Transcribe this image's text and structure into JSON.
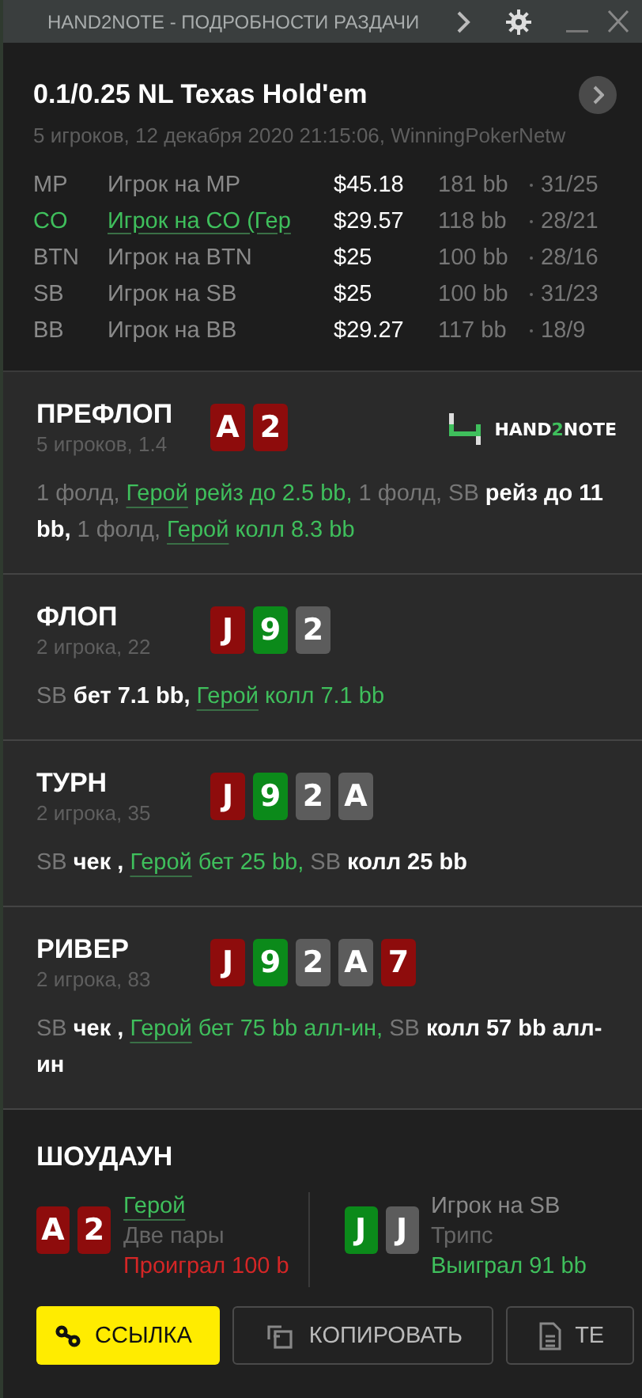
{
  "window": {
    "title": "HAND2NOTE - ПОДРОБНОСТИ РАЗДАЧИ"
  },
  "header": {
    "title": "0.1/0.25 NL Texas Hold'em",
    "subtitle": "5 игроков, 12 декабря 2020 21:15:06, WinningPokerNetw"
  },
  "players": [
    {
      "position": "MP",
      "name": "Игрок на MP",
      "stack": "$45.18",
      "bb": "181 bb",
      "stats": "31/25",
      "hero": false
    },
    {
      "position": "CO",
      "name": "Игрок на CO (Гер",
      "stack": "$29.57",
      "bb": "118 bb",
      "stats": "28/21",
      "hero": true
    },
    {
      "position": "BTN",
      "name": "Игрок на BTN",
      "stack": "$25",
      "bb": "100 bb",
      "stats": "28/16",
      "hero": false
    },
    {
      "position": "SB",
      "name": "Игрок на SB",
      "stack": "$25",
      "bb": "100 bb",
      "stats": "31/23",
      "hero": false
    },
    {
      "position": "BB",
      "name": "Игрок на BB",
      "stack": "$29.27",
      "bb": "117 bb",
      "stats": "18/9",
      "hero": false
    }
  ],
  "logo": {
    "before": "HAND",
    "accent": "2",
    "after": "NOTE"
  },
  "streets": [
    {
      "name": "ПРЕФЛОП",
      "info": "5 игроков, 1.4",
      "cards": [
        {
          "rank": "A",
          "color": "#8e0c0c"
        },
        {
          "rank": "2",
          "color": "#8e0c0c"
        }
      ],
      "actions": [
        {
          "kind": "muted",
          "text": "1 фолд, "
        },
        {
          "kind": "hero-link",
          "text": "Герой"
        },
        {
          "kind": "hero",
          "text": " рейз до 2.5 bb,"
        },
        {
          "kind": "muted",
          "text": " 1 фолд, SB"
        },
        {
          "kind": "strong",
          "text": " рейз до 11 bb,"
        },
        {
          "kind": "muted",
          "text": " 1 фолд, "
        },
        {
          "kind": "hero-link",
          "text": "Герой"
        },
        {
          "kind": "hero",
          "text": " колл 8.3 bb"
        }
      ]
    },
    {
      "name": "ФЛОП",
      "info": "2 игрока, 22",
      "cards": [
        {
          "rank": "J",
          "color": "#8e0c0c"
        },
        {
          "rank": "9",
          "color": "#0b8a1a"
        },
        {
          "rank": "2",
          "color": "#5c5c5c"
        }
      ],
      "actions": [
        {
          "kind": "muted",
          "text": "SB"
        },
        {
          "kind": "strong",
          "text": " бет 7.1 bb, "
        },
        {
          "kind": "hero-link",
          "text": "Герой"
        },
        {
          "kind": "hero",
          "text": " колл 7.1 bb"
        }
      ]
    },
    {
      "name": "ТУРН",
      "info": "2 игрока, 35",
      "cards": [
        {
          "rank": "J",
          "color": "#8e0c0c"
        },
        {
          "rank": "9",
          "color": "#0b8a1a"
        },
        {
          "rank": "2",
          "color": "#5c5c5c"
        },
        {
          "rank": "A",
          "color": "#5c5c5c"
        }
      ],
      "actions": [
        {
          "kind": "muted",
          "text": "SB"
        },
        {
          "kind": "strong",
          "text": " чек , "
        },
        {
          "kind": "hero-link",
          "text": "Герой"
        },
        {
          "kind": "hero",
          "text": " бет 25 bb,"
        },
        {
          "kind": "muted",
          "text": " SB"
        },
        {
          "kind": "strong",
          "text": " колл 25 bb"
        }
      ]
    },
    {
      "name": "РИВЕР",
      "info": "2 игрока, 83",
      "cards": [
        {
          "rank": "J",
          "color": "#8e0c0c"
        },
        {
          "rank": "9",
          "color": "#0b8a1a"
        },
        {
          "rank": "2",
          "color": "#5c5c5c"
        },
        {
          "rank": "A",
          "color": "#5c5c5c"
        },
        {
          "rank": "7",
          "color": "#8e0c0c"
        }
      ],
      "actions": [
        {
          "kind": "muted",
          "text": "SB"
        },
        {
          "kind": "strong",
          "text": " чек , "
        },
        {
          "kind": "hero-link",
          "text": "Герой"
        },
        {
          "kind": "hero",
          "text": " бет 75 bb алл-ин,"
        },
        {
          "kind": "muted",
          "text": " SB"
        },
        {
          "kind": "strong",
          "text": " колл 57 bb алл-ин"
        }
      ]
    }
  ],
  "showdown": {
    "title": "ШОУДАУН",
    "players": [
      {
        "name": "Герой",
        "hero": true,
        "hand": "Две пары",
        "result": "Проиграл 100 b",
        "won": false,
        "cards": [
          {
            "rank": "A",
            "color": "#8e0c0c"
          },
          {
            "rank": "2",
            "color": "#8e0c0c"
          }
        ]
      },
      {
        "name": "Игрок на SB",
        "hero": false,
        "hand": "Трипс",
        "result": "Выиграл 91 bb",
        "won": true,
        "cards": [
          {
            "rank": "J",
            "color": "#0b8a1a"
          },
          {
            "rank": "J",
            "color": "#5c5c5c"
          }
        ]
      }
    ]
  },
  "buttons": [
    {
      "label": "ССЫЛКА",
      "kind": "primary"
    },
    {
      "label": "КОПИРОВАТЬ",
      "kind": "secondary"
    },
    {
      "label": "ТЕ",
      "kind": "secondary"
    }
  ]
}
